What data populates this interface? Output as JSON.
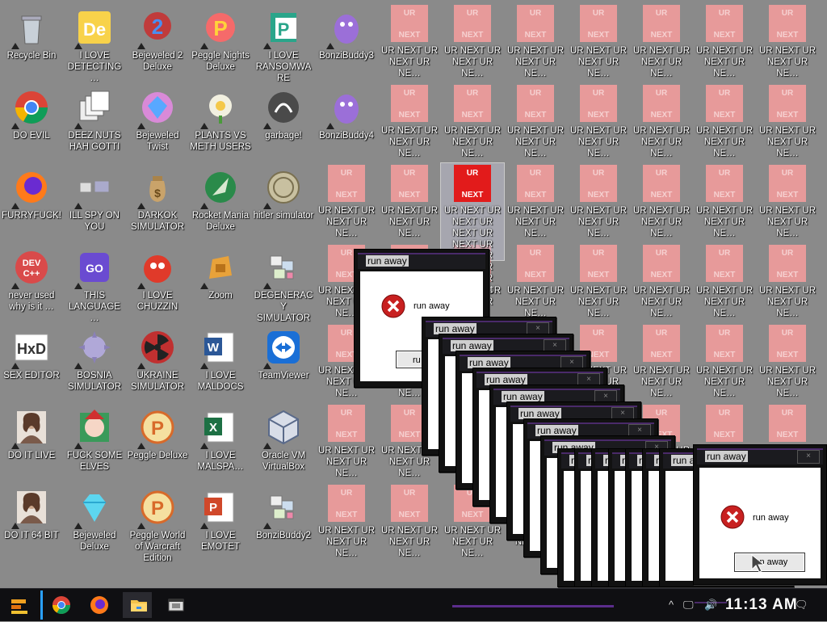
{
  "desktop": {
    "icons": [
      {
        "label": "Recycle Bin",
        "icon": "recycle-bin-icon"
      },
      {
        "label": "I LOVE DETECTING…",
        "icon": "de-app-icon"
      },
      {
        "label": "Bejeweled 2 Deluxe",
        "icon": "bejeweled-2-icon"
      },
      {
        "label": "Peggle Nights Deluxe",
        "icon": "peggle-nights-icon"
      },
      {
        "label": "I LOVE RANSOMWARE",
        "icon": "publisher-icon"
      },
      {
        "label": "BonziBuddy3",
        "icon": "bonzibuddy-icon"
      },
      {
        "label": "DO EVIL",
        "icon": "chrome-icon"
      },
      {
        "label": "DEEZ NUTS HAH GOTTI",
        "icon": "copy-windows-icon"
      },
      {
        "label": "Bejeweled Twist",
        "icon": "bejeweled-twist-icon"
      },
      {
        "label": "PLANTS VS METH USERS",
        "icon": "plants-vs-zombies-icon"
      },
      {
        "label": "garbage!",
        "icon": "garbage-icon"
      },
      {
        "label": "BonziBuddy4",
        "icon": "bonzibuddy-icon"
      },
      {
        "label": "FURRYFUCK!",
        "icon": "firefox-icon"
      },
      {
        "label": "ILL SPY ON YOU",
        "icon": "spy-icon"
      },
      {
        "label": "DARKOK SIMULATOR",
        "icon": "money-bag-icon"
      },
      {
        "label": "Rocket Mania Deluxe",
        "icon": "rocket-mania-icon"
      },
      {
        "label": "hitler simulator",
        "icon": "coin-icon"
      },
      {
        "label": "never used why is it …",
        "icon": "devcpp-icon"
      },
      {
        "label": "THIS LANGUAGE …",
        "icon": "go-icon"
      },
      {
        "label": "I LOVE CHUZZIN",
        "icon": "chuzzle-icon"
      },
      {
        "label": "Zoom",
        "icon": "zuma-icon"
      },
      {
        "label": "DEGENERACY SIMULATOR",
        "icon": "blocks-icon"
      },
      {
        "label": "SEX EDITOR",
        "icon": "hxd-icon"
      },
      {
        "label": "BOSNIA SIMULATOR",
        "icon": "spiked-ball-icon"
      },
      {
        "label": "UKRAINE SIMULATOR",
        "icon": "radiation-icon"
      },
      {
        "label": "I LOVE MALDOCS",
        "icon": "word-icon"
      },
      {
        "label": "TeamViewer",
        "icon": "teamviewer-icon"
      },
      {
        "label": "DO IT LIVE",
        "icon": "portrait-icon"
      },
      {
        "label": "FUCK SOME ELVES",
        "icon": "elves-icon"
      },
      {
        "label": "Peggle Deluxe",
        "icon": "peggle-icon"
      },
      {
        "label": "I LOVE MALSPA…",
        "icon": "excel-icon"
      },
      {
        "label": "Oracle VM VirtualBox",
        "icon": "virtualbox-icon"
      },
      {
        "label": "DO IT 64 BIT",
        "icon": "portrait-icon"
      },
      {
        "label": "Bejeweled Deluxe",
        "icon": "diamond-icon"
      },
      {
        "label": "Peggle World of Warcraft Edition",
        "icon": "peggle-icon"
      },
      {
        "label": "I LOVE EMOTET",
        "icon": "powerpoint-icon"
      },
      {
        "label": "BonziBuddy2",
        "icon": "blocks-icon"
      }
    ],
    "ur_tile": {
      "top": "UR",
      "bottom": "NEXT",
      "label": "UR NEXT UR NEXT UR NE…"
    },
    "ur_selected_label": "UR NEXT UR NEXT UR NEXT UR NEXT UR NEXT UR NEXT UR NEXT UR N14XT.txt"
  },
  "dialog": {
    "title": "run away",
    "message": "run away",
    "button": "run away",
    "button_partial": "ru"
  },
  "taskbar": {
    "clock": "11:13 AM",
    "apps": [
      "start-icon",
      "chrome-icon",
      "firefox-icon",
      "folder-icon",
      "app-window-icon"
    ]
  }
}
